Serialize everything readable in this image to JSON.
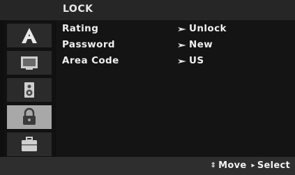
{
  "header": {
    "title": "LOCK"
  },
  "sidebar": {
    "tabs": [
      {
        "name": "language-tab-icon",
        "active": false
      },
      {
        "name": "display-tab-icon",
        "active": false
      },
      {
        "name": "audio-tab-icon",
        "active": false
      },
      {
        "name": "lock-tab-icon",
        "active": true
      },
      {
        "name": "others-tab-icon",
        "active": false
      }
    ]
  },
  "menu": {
    "rows": [
      {
        "label": "Rating",
        "value": "Unlock"
      },
      {
        "label": "Password",
        "value": "New"
      },
      {
        "label": "Area Code",
        "value": "US"
      }
    ]
  },
  "footer": {
    "move_glyph": "⇕",
    "move_label": "Move",
    "select_glyph": "▸",
    "select_label": "Select"
  },
  "colors": {
    "background": "#0f0f0f",
    "active_tab": "#a8a8a8",
    "text": "#f0f0f0"
  }
}
